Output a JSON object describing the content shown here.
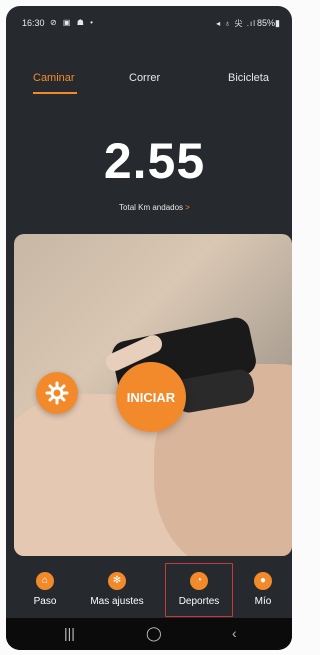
{
  "status_bar": {
    "time": "16:30",
    "left_icons": "⊘ ▣ ☗ •",
    "right_icons": "◂ ♁ 尖 .ıl",
    "battery": "85%▮"
  },
  "tabs": [
    {
      "label": "Caminar",
      "active": true
    },
    {
      "label": "Correr",
      "active": false
    },
    {
      "label": "Bicicleta",
      "active": false
    }
  ],
  "metric": {
    "value": "2.55",
    "label": "Total Km andados",
    "chevron": ">"
  },
  "actions": {
    "start_label": "INICIAR",
    "settings_icon": "gear-icon"
  },
  "bottom_nav": [
    {
      "label": "Paso",
      "icon": "home-icon"
    },
    {
      "label": "Mas ajustes",
      "icon": "gear-icon"
    },
    {
      "label": "Deportes",
      "icon": "sports-icon"
    },
    {
      "label": "Mío",
      "icon": "profile-icon"
    }
  ],
  "android_nav": {
    "recent": "|||",
    "home": "◯",
    "back": "‹"
  },
  "colors": {
    "accent": "#f28a2c",
    "background": "#262a2e",
    "text": "#ffffff"
  }
}
